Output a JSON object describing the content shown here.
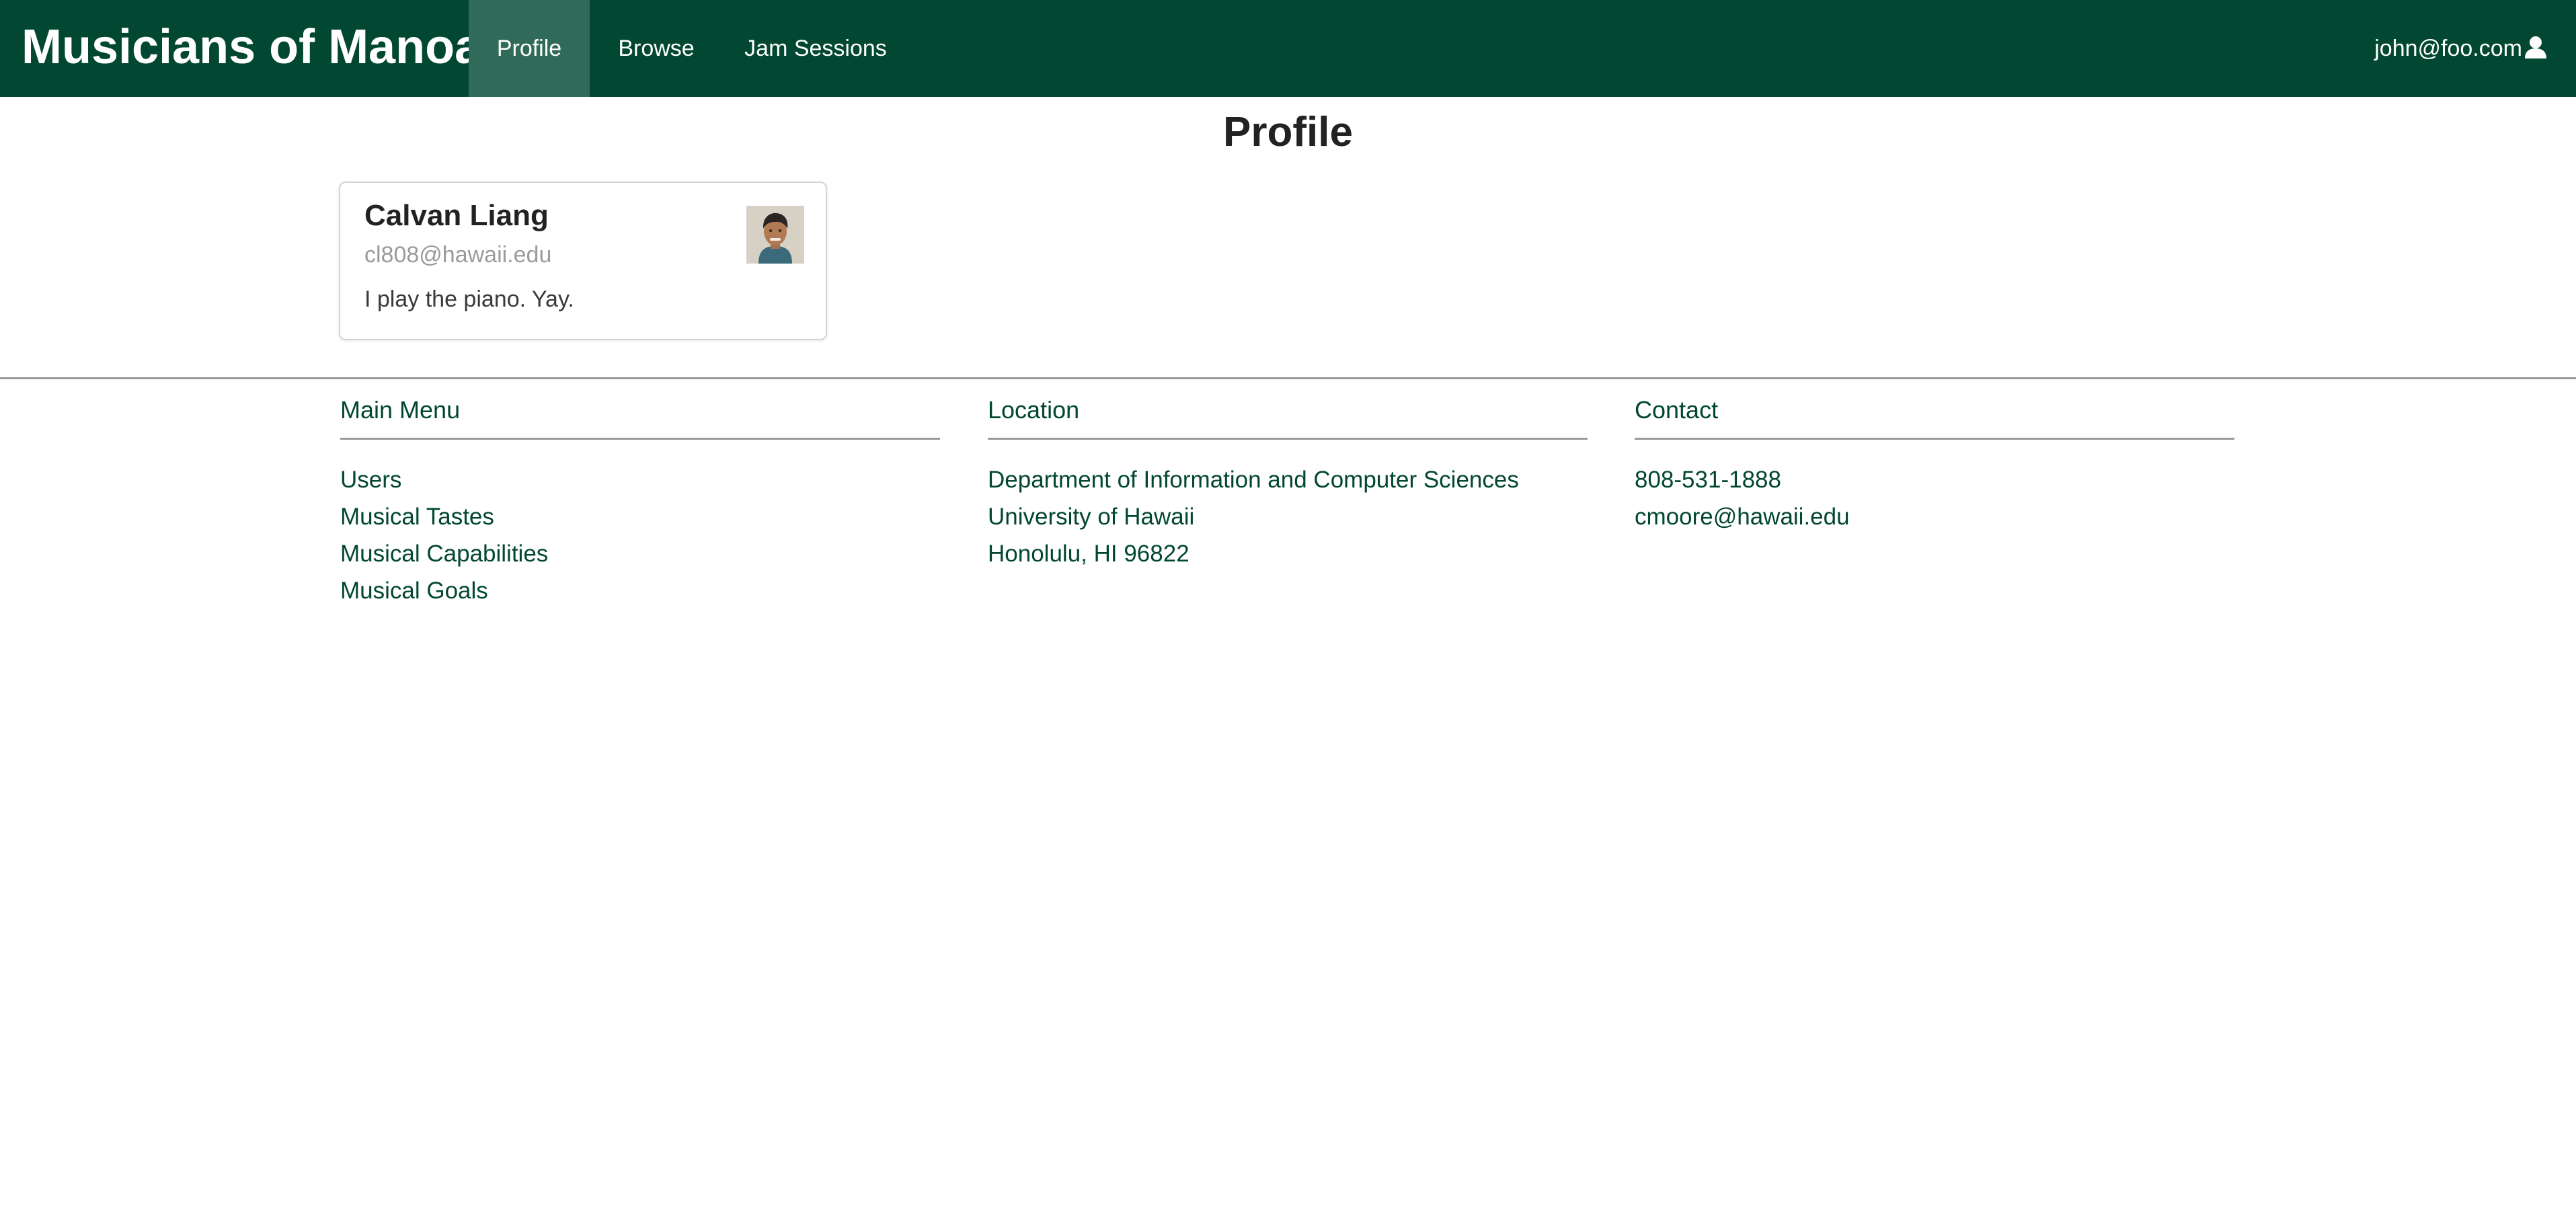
{
  "navbar": {
    "brand": "Musicians of Manoa",
    "items": [
      {
        "label": "Profile",
        "active": true
      },
      {
        "label": "Browse",
        "active": false
      },
      {
        "label": "Jam Sessions",
        "active": false
      }
    ],
    "user_label": "john@foo.com",
    "user_icon": "user-icon"
  },
  "page": {
    "title": "Profile"
  },
  "profile_card": {
    "name": "Calvan Liang",
    "email": "cl808@hawaii.edu",
    "bio": "I play the piano. Yay."
  },
  "footer": {
    "main_menu": {
      "heading": "Main Menu",
      "items": [
        "Users",
        "Musical Tastes",
        "Musical Capabilities",
        "Musical Goals"
      ]
    },
    "location": {
      "heading": "Location",
      "lines": [
        "Department of Information and Computer Sciences",
        "University of Hawaii",
        "Honolulu, HI 96822"
      ]
    },
    "contact": {
      "heading": "Contact",
      "lines": [
        "808-531-1888",
        "cmoore@hawaii.edu"
      ]
    }
  },
  "colors": {
    "brand_green": "#024731",
    "active_nav": "#2f6b58",
    "muted_text": "#9b9b9b"
  }
}
